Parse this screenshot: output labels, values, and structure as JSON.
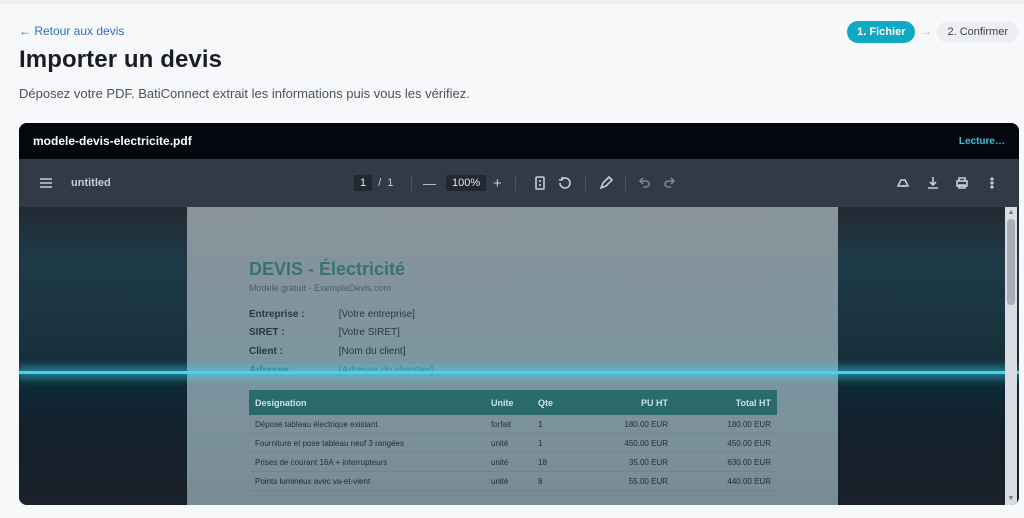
{
  "nav": {
    "back_label": "← Retour aux devis"
  },
  "header": {
    "title": "Importer un devis",
    "subtitle": "Déposez votre PDF. BatiConnect extrait les informations puis vous les vérifiez."
  },
  "stepper": {
    "step1": "1. Fichier",
    "separator": "→",
    "step2": "2. Confirmer"
  },
  "viewer": {
    "file_name": "modele-devis-electricite.pdf",
    "status": "Lecture…"
  },
  "pdf_toolbar": {
    "doc_title": "untitled",
    "page_current": "1",
    "page_separator": "/",
    "page_total": "1",
    "zoom": "100%",
    "zoom_out": "—",
    "zoom_in": "+"
  },
  "document": {
    "title": "DEVIS - Électricité",
    "subtitle": "Modele gratuit - ExempleDevis.com",
    "fields": [
      {
        "label": "Entreprise :",
        "value": "[Votre entreprise]"
      },
      {
        "label": "SIRET :",
        "value": "[Votre SIRET]"
      },
      {
        "label": "Client :",
        "value": "[Nom du client]"
      },
      {
        "label": "Adresse :",
        "value": "[Adresse du chantier]"
      }
    ],
    "table": {
      "headers": [
        "Designation",
        "Unite",
        "Qte",
        "PU HT",
        "Total HT"
      ],
      "rows": [
        [
          "Dépose tableau électrique existant",
          "forfait",
          "1",
          "180.00 EUR",
          "180.00 EUR"
        ],
        [
          "Fourniture et pose tableau neuf 3 rangées",
          "unité",
          "1",
          "450.00 EUR",
          "450.00 EUR"
        ],
        [
          "Prises de courant 16A + interrupteurs",
          "unité",
          "18",
          "35.00 EUR",
          "630.00 EUR"
        ],
        [
          "Points lumineux avec va-et-vient",
          "unité",
          "8",
          "55.00 EUR",
          "440.00 EUR"
        ]
      ]
    }
  },
  "colors": {
    "accent": "#10a9c4",
    "link": "#2b6fc6",
    "scan": "#3cd8f2",
    "table_header": "#1b5b55"
  },
  "icons": {
    "sidebar": "hamburger-icon",
    "page_fit": "page-fit-icon",
    "rotate": "rotate-icon",
    "annotate": "pen-icon",
    "undo": "undo-icon",
    "redo": "redo-icon",
    "save_drive": "drive-icon",
    "download": "download-icon",
    "print": "print-icon",
    "more": "more-vertical-icon"
  }
}
